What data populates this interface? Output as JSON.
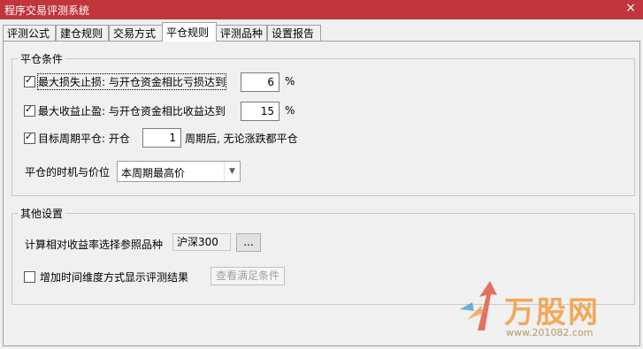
{
  "window": {
    "title": "程序交易评测系统",
    "close_label": "×"
  },
  "tabs": [
    "评测公式",
    "建仓规则",
    "交易方式",
    "平仓规则",
    "评测品种",
    "设置报告"
  ],
  "close_conditions": {
    "legend": "平仓条件",
    "stop_loss": {
      "label": "最大损失止损: 与开仓资金相比亏损达到",
      "value": "6",
      "unit": "%",
      "checked": true
    },
    "take_profit": {
      "label": "最大收益止盈: 与开仓资金相比收益达到",
      "value": "15",
      "unit": "%",
      "checked": true
    },
    "period_close": {
      "label_before": "目标周期平仓: 开仓",
      "value": "1",
      "label_after": "周期后, 无论涨跌都平仓",
      "checked": true
    },
    "timing_label": "平仓的时机与价位",
    "timing_value": "本周期最高价"
  },
  "other_settings": {
    "legend": "其他设置",
    "reference_label": "计算相对收益率选择参照品种",
    "reference_value": "沪深300",
    "browse_label": "...",
    "time_dimension": {
      "label": "增加时间维度方式显示评测结果",
      "checked": false
    },
    "view_conditions_label": "查看满足条件"
  },
  "watermark": {
    "brand": "万股网",
    "url": "www.201082.com"
  }
}
